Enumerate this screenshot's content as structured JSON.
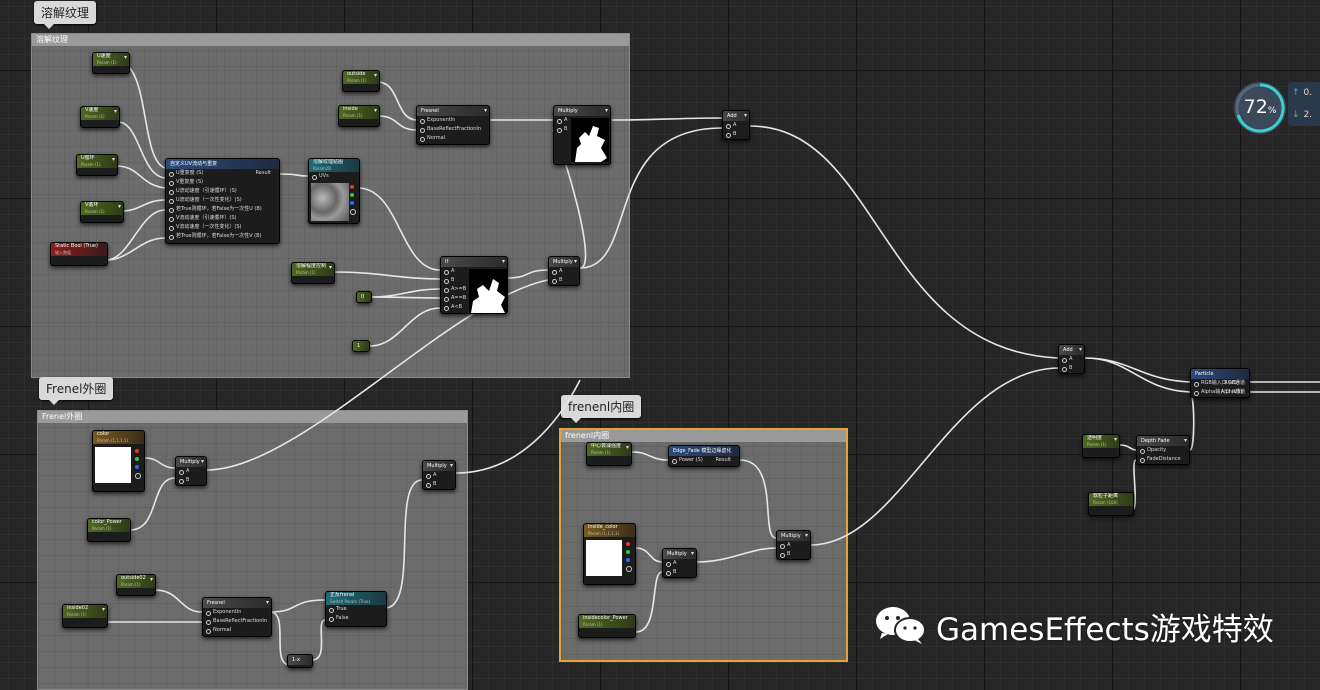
{
  "comments": [
    {
      "title": "溶解纹理",
      "bubble": "溶解纹理"
    },
    {
      "title": "Frenel外圈",
      "bubble": "Frenel外圈"
    },
    {
      "title": "frenenl内圈",
      "bubble": "frenenl内圈"
    }
  ],
  "nodes": {
    "u_speed": {
      "title": "U速度",
      "sub": "Param (1)"
    },
    "v_speed": {
      "title": "V速度",
      "sub": "Param (1)"
    },
    "u_loop": {
      "title": "U循环",
      "sub": "Param (1)"
    },
    "v_loop": {
      "title": "V循环",
      "sub": "Param (1)"
    },
    "static_bool": {
      "title": "Static Bool (True)",
      "sub": "输入数值"
    },
    "outside": {
      "title": "outside",
      "sub": "Param (1)"
    },
    "inside": {
      "title": "inside",
      "sub": "Param (1)"
    },
    "fresnel_top": {
      "title": "Fresnel",
      "pins": [
        "ExponentIn",
        "BaseReflectFractionIn",
        "Normal"
      ]
    },
    "multiply_top": {
      "title": "Multiply",
      "pins": [
        "A",
        "B"
      ]
    },
    "add_top": {
      "title": "Add",
      "pins": [
        "A",
        "B"
      ]
    },
    "uv_func": {
      "title": "自定义UV流动与重复",
      "pins": [
        "U重复度 (S)",
        "V重复度 (S)",
        "U流动速度（引速循环）(S)",
        "U流动速度（一次性变化）(S)",
        "若True则循环，若False为一次性U (B)",
        "V流动速度（引速循环）(S)",
        "V流动速度（一次性变化）(S)",
        "若True则循环，若False为一次性V (B)"
      ],
      "out": "Result"
    },
    "dissolve_tex": {
      "title": "溶解纹理贴图",
      "sub": "Param2D",
      "pin": "UVs"
    },
    "dissolve_param": {
      "title": "溶解程度控制",
      "sub": "Param (1)"
    },
    "const_0": {
      "title": "0"
    },
    "const_1": {
      "title": "1"
    },
    "if_node": {
      "title": "If",
      "pins": [
        "A",
        "B",
        "A>=B",
        "A==B",
        "A<B"
      ]
    },
    "multiply_mid": {
      "title": "Multiply",
      "pins": [
        "A",
        "B"
      ]
    },
    "color": {
      "title": "color",
      "sub": "Param (1,1,1,1)"
    },
    "color_power": {
      "title": "color_Power",
      "sub": "Param (1)"
    },
    "multiply_l1": {
      "title": "Multiply",
      "pins": [
        "A",
        "B"
      ]
    },
    "multiply_l2": {
      "title": "Multiply",
      "pins": [
        "A",
        "B"
      ]
    },
    "outside02": {
      "title": "outside02",
      "sub": "Param (1)"
    },
    "inside02": {
      "title": "inside02",
      "sub": "Param (1)"
    },
    "fresnel_low": {
      "title": "Fresnel",
      "pins": [
        "ExponentIn",
        "BaseReflectFractionIn",
        "Normal"
      ]
    },
    "switch_fresnel": {
      "title": "正反frenel",
      "sub": "Switch Param (True)",
      "pins": [
        "True",
        "False"
      ]
    },
    "one_minus": {
      "title": "1-x"
    },
    "center_fade": {
      "title": "中心衰减强度",
      "sub": "Param (1)"
    },
    "edge_fade": {
      "title": "Edge_Fade 模型边缘虚化",
      "pins": [
        "Power (S)"
      ],
      "out": "Result"
    },
    "inside_color": {
      "title": "inside_color",
      "sub": "Param (1,1,1,1)"
    },
    "multiply_in1": {
      "title": "Multiply",
      "pins": [
        "A",
        "B"
      ]
    },
    "multiply_in2": {
      "title": "Multiply",
      "pins": [
        "A",
        "B"
      ]
    },
    "inside_power": {
      "title": "insidecolor_Power",
      "sub": "Param (1)"
    },
    "add_right": {
      "title": "Add",
      "pins": [
        "A",
        "B"
      ]
    },
    "transparency": {
      "title": "透明度",
      "sub": "Param (1)"
    },
    "soft_particle": {
      "title": "软粒子距离",
      "sub": "Param (100)"
    },
    "depth_fade": {
      "title": "Depth Fade",
      "pins": [
        "Opacity",
        "FadeDistance"
      ]
    },
    "particle": {
      "title": "Particle",
      "pins": [
        "RGB输入口 (V3)",
        "Alpha输入口 (V3)"
      ],
      "outs": [
        "RGB通道",
        "Alpha通道"
      ]
    }
  },
  "watermark": "GamesEffects游戏特效",
  "meter": {
    "value": "72",
    "unit": "%",
    "up": "0.",
    "down": "2."
  }
}
